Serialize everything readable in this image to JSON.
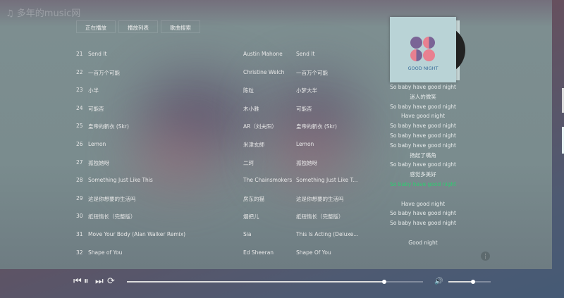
{
  "app": {
    "logo": "♫ 多年的music网"
  },
  "tabs": [
    {
      "label": "正在播放"
    },
    {
      "label": "播放列表"
    },
    {
      "label": "歌曲搜索"
    }
  ],
  "songs": [
    {
      "num": "21",
      "title": "Send It",
      "artist": "Austin Mahone",
      "album": "Send It"
    },
    {
      "num": "22",
      "title": "一百万个可能",
      "artist": "Christine Welch",
      "album": "一百万个可能"
    },
    {
      "num": "23",
      "title": "小半",
      "artist": "陈粒",
      "album": "小梦大半"
    },
    {
      "num": "24",
      "title": "可能否",
      "artist": "木小雅",
      "album": "可能否"
    },
    {
      "num": "25",
      "title": "皇帝的新衣 (Skr)",
      "artist": "AR（刘夫阳）",
      "album": "皇帝的新衣 (Skr)"
    },
    {
      "num": "26",
      "title": "Lemon",
      "artist": "米津玄師",
      "album": "Lemon"
    },
    {
      "num": "27",
      "title": "孤独她呀",
      "artist": "二珂",
      "album": "孤独她呀"
    },
    {
      "num": "28",
      "title": "Something Just Like This",
      "artist": "The Chainsmokers",
      "album": "Something Just Like T..."
    },
    {
      "num": "29",
      "title": "这是你想要的生活吗",
      "artist": "房东的猫",
      "album": "这是你想要的生活吗"
    },
    {
      "num": "30",
      "title": "纸短情长（完整版）",
      "artist": "烟把儿",
      "album": "纸短情长（完整版）"
    },
    {
      "num": "31",
      "title": "Move Your Body (Alan Walker Remix)",
      "artist": "Sia",
      "album": "This Is Acting (Deluxe..."
    },
    {
      "num": "32",
      "title": "Shape of You",
      "artist": "Ed Sheeran",
      "album": "Shape Of You"
    }
  ],
  "album_cover": {
    "text": "GOOD NIGHT"
  },
  "lyrics": [
    {
      "text": "So baby have good night"
    },
    {
      "text": "迷人的微笑"
    },
    {
      "text": "So baby have good night"
    },
    {
      "text": "Have good night"
    },
    {
      "text": "So baby have good night"
    },
    {
      "text": "So baby have good night"
    },
    {
      "text": "So baby have good night"
    },
    {
      "text": "扬起了嘴角"
    },
    {
      "text": "So baby have good night"
    },
    {
      "text": "感觉多美好"
    },
    {
      "text": "So baby have good night",
      "active": true
    },
    {
      "text": ""
    },
    {
      "text": "Have good night"
    },
    {
      "text": "So baby have good night"
    },
    {
      "text": "So baby have good night"
    },
    {
      "text": ""
    },
    {
      "text": "Good night"
    }
  ],
  "player": {
    "progress_percent": 87,
    "volume_percent": 58,
    "active_lyric_color": "#2ecc71"
  },
  "icons": {
    "prev": "⏮",
    "pause": "⏸",
    "next": "⏭",
    "loop": "⟳",
    "volume": "🔊",
    "more": "⋮"
  }
}
